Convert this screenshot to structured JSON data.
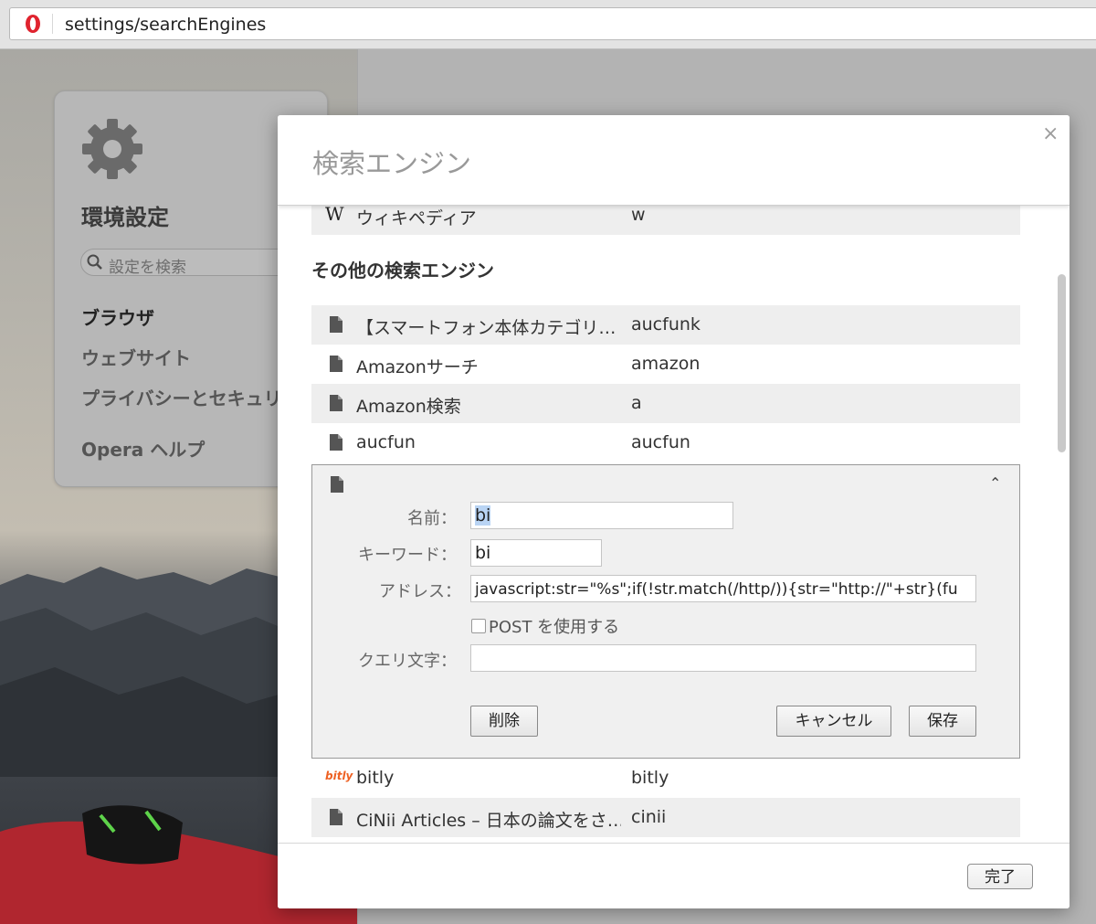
{
  "address_bar": {
    "url": "settings/searchEngines"
  },
  "sidebar": {
    "title": "環境設定",
    "search_placeholder": "設定を検索",
    "nav": [
      {
        "label": "ブラウザ",
        "active": true
      },
      {
        "label": "ウェブサイト",
        "active": false
      },
      {
        "label": "プライバシーとセキュリ",
        "active": false
      },
      {
        "label": "Opera ヘルプ",
        "active": false
      }
    ]
  },
  "dialog": {
    "title": "検索エンジン",
    "close_icon": "×",
    "top_row": {
      "name": "ウィキペディア",
      "keyword": "w",
      "icon": "wikipedia-icon"
    },
    "other_section_title": "その他の検索エンジン",
    "engines": [
      {
        "name": "【スマートフォン本体カテゴリ…",
        "keyword": "aucfunk"
      },
      {
        "name": "Amazonサーチ",
        "keyword": "amazon"
      },
      {
        "name": "Amazon検索",
        "keyword": "a"
      },
      {
        "name": "aucfun",
        "keyword": "aucfun"
      }
    ],
    "edit": {
      "caret": "⌃",
      "name_label": "名前：",
      "name_value": "bi",
      "keyword_label": "キーワード：",
      "keyword_value": "bi",
      "address_label": "アドレス：",
      "address_value": "javascript:str=\"%s\";if(!str.match(/http/)){str=\"http://\"+str}(fu",
      "post_label": "POST を使用する",
      "query_label": "クエリ文字：",
      "query_value": "",
      "delete_label": "削除",
      "cancel_label": "キャンセル",
      "save_label": "保存"
    },
    "engines_after": [
      {
        "name": "bitly",
        "keyword": "bitly",
        "icon": "bitly-icon",
        "icon_text": "bitly"
      },
      {
        "name": "CiNii Articles – 日本の論文をさ…",
        "keyword": "cinii"
      }
    ],
    "done_label": "完了"
  },
  "colors": {
    "opera_red": "#e0232e",
    "bitly_orange": "#ee6123"
  }
}
